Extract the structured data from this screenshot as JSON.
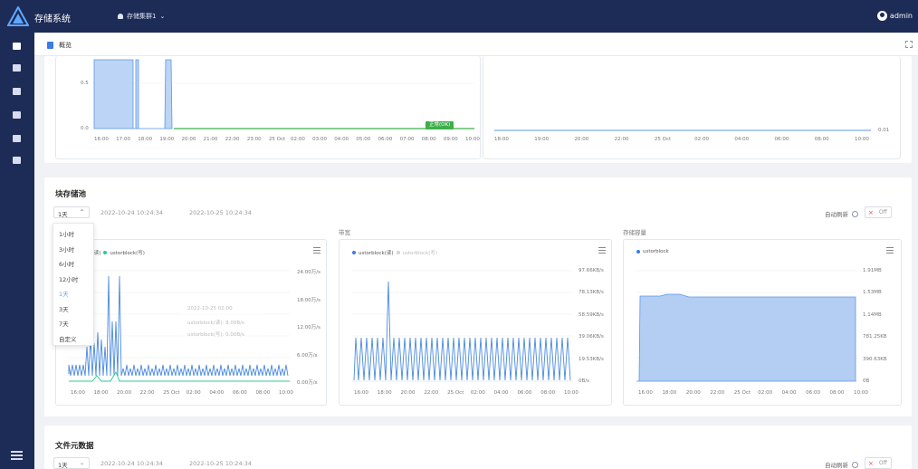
{
  "app": {
    "title": "存储系统",
    "cluster": "存储集群1",
    "user": "admin"
  },
  "colors": {
    "nav": "#1d2b57",
    "primary": "#3b7ce6",
    "ok": "#3caf4a",
    "series_green": "#2cc99a",
    "fill": "#a8c8f5"
  },
  "tab": {
    "label": "概览"
  },
  "top_charts": {
    "left": {
      "y_ticks": [
        "0.5",
        "0.0"
      ],
      "badge": "正常(OK)",
      "x_ticks": [
        "16:00",
        "17:00",
        "18:00",
        "19:00",
        "20:00",
        "21:00",
        "22:00",
        "23:00",
        "25 Oct",
        "02:00",
        "03:00",
        "04:00",
        "05:00",
        "06:00",
        "07:00",
        "08:00",
        "09:00",
        "10:00"
      ]
    },
    "right": {
      "y_tick": "0.01",
      "x_ticks": [
        "18:00",
        "19:00",
        "20:00",
        "22:00",
        "25 Oct",
        "02:00",
        "04:00",
        "06:00",
        "08:00",
        "10:00"
      ]
    }
  },
  "block_storage": {
    "title": "块存储池",
    "range": "1天",
    "start": "2022-10-24 10:24:34",
    "end": "2022-10-25 10:24:34",
    "auto_refresh_label": "自动刷新",
    "switch_label": "Off",
    "range_options": [
      "1小时",
      "3小时",
      "6小时",
      "12小时",
      "1天",
      "3天",
      "7天",
      "自定义"
    ],
    "tooltip": {
      "title": "2022-10-25 02:00",
      "line1": "ustorblock(读): 8.00B/s",
      "line2": "ustorblock(写): 0.00B/s"
    },
    "chart_bw": {
      "legend_read": "ock(读)",
      "legend_write": "ustorblock(写)",
      "y_ticks": [
        "24.00万/s",
        "18.00万/s",
        "12.00万/s",
        "6.00万/s",
        "0.00万/s"
      ],
      "x_ticks": [
        "16:00",
        "18:00",
        "20:00",
        "22:00",
        "25 Oct",
        "02:00",
        "04:00",
        "06:00",
        "08:00",
        "10:00"
      ]
    },
    "chart_bw2": {
      "title": "带宽",
      "legend_read": "ustorblock(读)",
      "legend_write": "ustorblock(写)",
      "y_ticks": [
        "97.66KB/s",
        "78.13KB/s",
        "58.59KB/s",
        "39.06KB/s",
        "19.53KB/s",
        "0B/s"
      ],
      "x_ticks": [
        "16:00",
        "18:00",
        "20:00",
        "22:00",
        "25 Oct",
        "02:00",
        "04:00",
        "06:00",
        "08:00",
        "10:00"
      ]
    },
    "chart_cap": {
      "title": "存储容量",
      "legend": "ustorblock",
      "y_ticks": [
        "1.91MB",
        "1.53MB",
        "1.14MB",
        "781.25KB",
        "390.63KB",
        "0B"
      ],
      "x_ticks": [
        "16:00",
        "18:00",
        "20:00",
        "22:00",
        "25 Oct",
        "02:00",
        "04:00",
        "06:00",
        "08:00",
        "10:00"
      ]
    }
  },
  "file_meta": {
    "title": "文件元数据",
    "range": "1天",
    "start": "2022-10-24 10:24:34",
    "end": "2022-10-25 10:24:34",
    "auto_refresh_label": "自动刷新",
    "switch_label": "Off"
  }
}
